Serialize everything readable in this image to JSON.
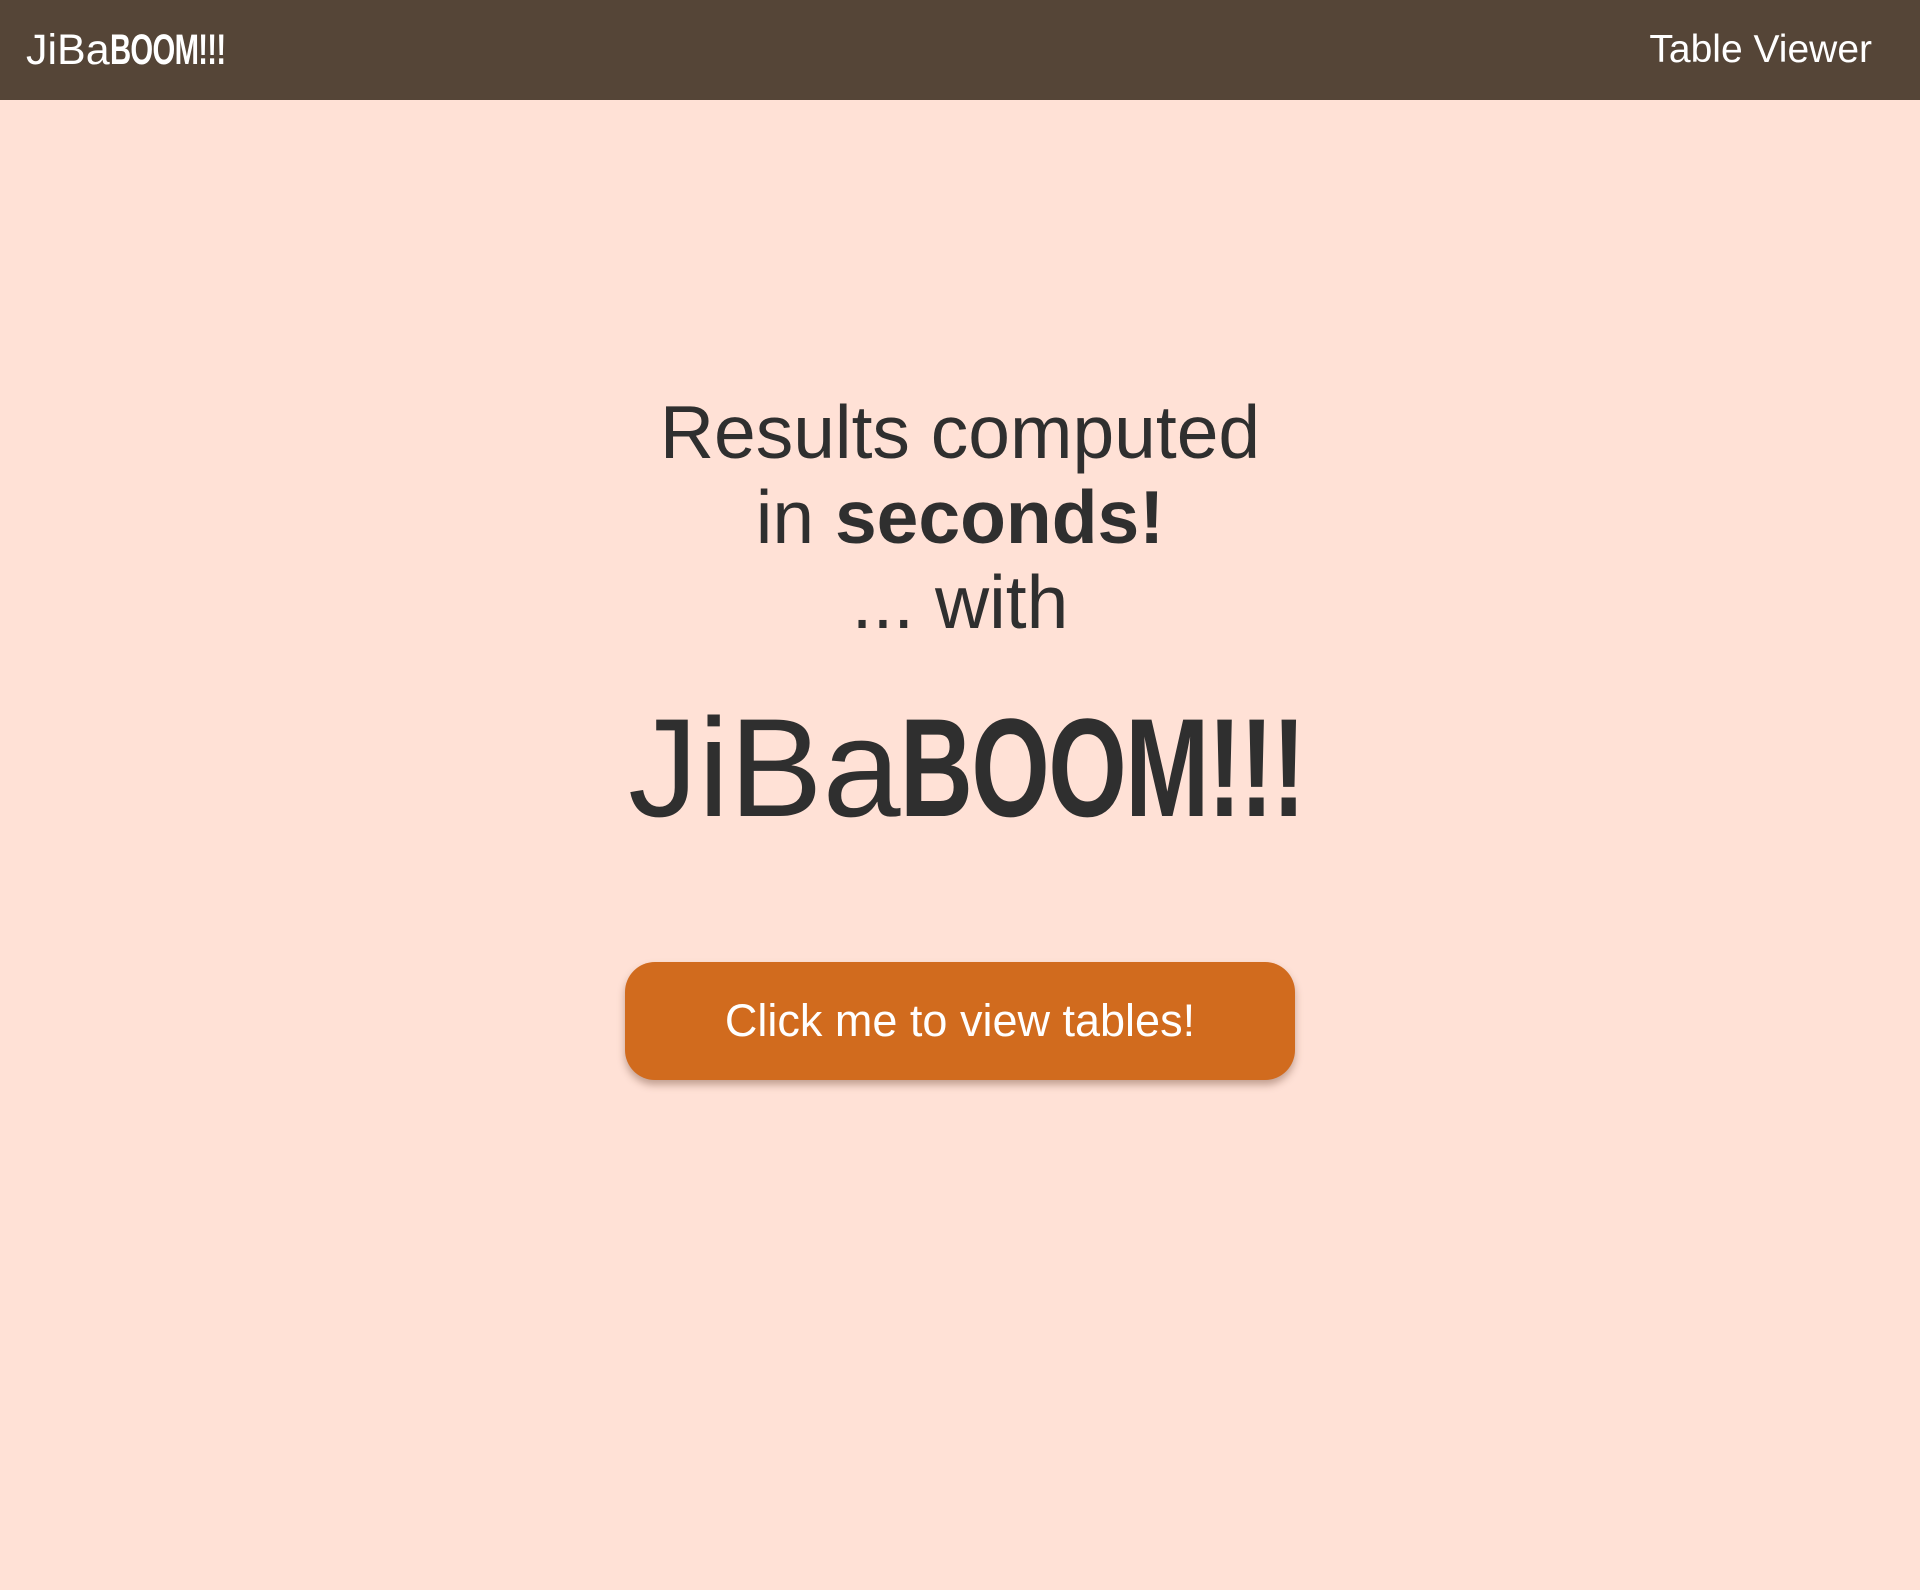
{
  "navbar": {
    "brand_prefix": "JiBa",
    "brand_suffix": "BOOM!!!",
    "link_label": "Table Viewer"
  },
  "hero": {
    "line1": "Results computed",
    "line2_prefix": "in ",
    "line2_emphasis": "seconds!",
    "line3": "... with",
    "logo_prefix": "JiBa",
    "logo_suffix": "BOOM!!!"
  },
  "cta": {
    "label": "Click me to view tables!"
  },
  "colors": {
    "navbar_bg": "#554537",
    "page_bg": "#ffe1d6",
    "accent": "#d16b1e",
    "text": "#2f2f2f"
  }
}
